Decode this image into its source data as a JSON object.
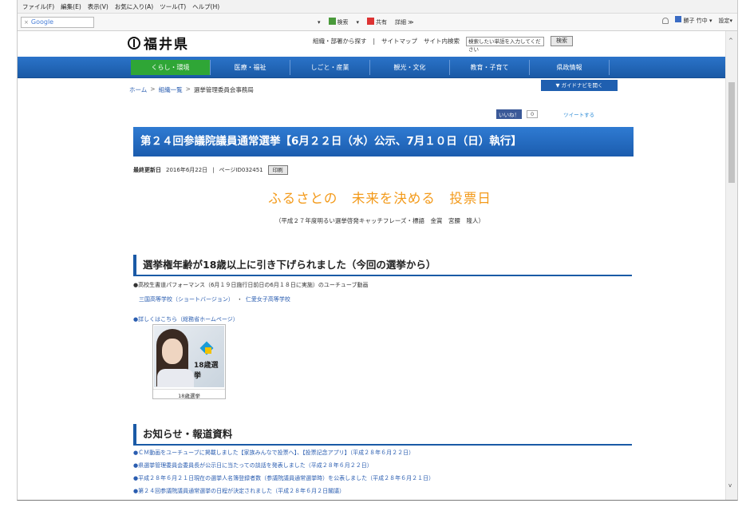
{
  "menu": [
    "ファイル(F)",
    "編集(E)",
    "表示(V)",
    "お気に入り(A)",
    "ツール(T)",
    "ヘルプ(H)"
  ],
  "toolbar": {
    "google_close": "×",
    "google_label": "Google",
    "items": [
      "▾",
      "検索",
      "▾",
      "共有",
      "詳細 ≫"
    ],
    "user_name": "勝子 竹中 ▾",
    "settings": "設定▾"
  },
  "header": {
    "logo": "福井県",
    "links": [
      "組織・部署から探す",
      "|",
      "サイトマップ",
      "サイト内検索"
    ],
    "search_placeholder": "検索したい単語を入力してください",
    "search_button": "検索"
  },
  "nav": [
    "くらし・環境",
    "医療・福祉",
    "しごと・産業",
    "観光・文化",
    "教育・子育て",
    "県政情報"
  ],
  "breadcrumb": [
    "ホーム",
    ">",
    "組織一覧",
    ">",
    "選挙管理委員会事務局"
  ],
  "guide_button": "▼ ガイドナビを開く",
  "social": {
    "like": "いいね！",
    "like_count": "0",
    "tweet": "ツイートする"
  },
  "title": "第２４回参議院議員通常選挙【6月２２日（水）公示、7月１０日（日）執行】",
  "meta": {
    "updated_label": "最終更新日",
    "updated_date": "2016年6月22日",
    "sep": "|",
    "page_id_label": "ページID",
    "page_id": "032451",
    "print": "印刷"
  },
  "catchphrase": "ふるさとの　未来を決める　投票日",
  "catch_sub": "（平成２７年度明るい選挙啓発キャッチフレーズ・標語　金賞　宮腰　隆人）",
  "section1": {
    "heading": "選挙権年齢が18歳以上に引き下げられました（今回の選挙から）",
    "bullet1": "●高校生書道パフォーマンス（6月１９日施行日前日の6月１８日に実施）のユーチューブ動画",
    "sublinks": [
      "三国高等学校（ショートバージョン）",
      "・",
      "仁愛女子高等学校"
    ],
    "bullet2": "●詳しくはこちら（総務省ホームページ）",
    "banner_text": "18歳選挙",
    "banner_caption": "18歳選挙"
  },
  "section2": {
    "heading": "お知らせ・報道資料",
    "items": [
      "●ＣＭ動画をユーチューブに掲載しました【家族みんなで投票へ】、【投票記念アプリ】（平成２８年６月２２日）",
      "●県選挙管理委員会委員長が公示日に当たっての談話を発表しました（平成２８年６月２２日）",
      "●平成２８年６月２１日現在の選挙人名簿登録者数（参議院議員通常選挙時）を公表しました（平成２８年６月２１日）",
      "●第２４回参議院議員通常選挙の日程が決定されました（平成２８年６月２日閣議）"
    ]
  },
  "colors": {
    "nav_blue": "#1a5aa6",
    "active_green": "#2fa636",
    "catch_orange": "#f39a1a"
  }
}
